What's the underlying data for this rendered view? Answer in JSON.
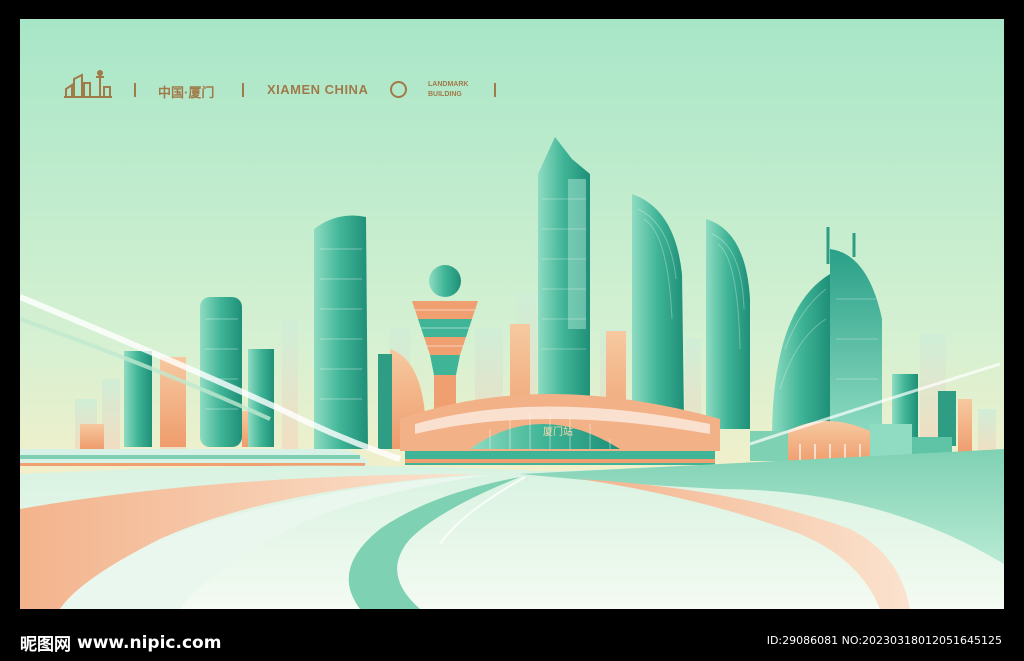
{
  "header": {
    "cn_city": "中国·厦门",
    "en_city": "XIAMEN CHINA",
    "landmark_line1": "LANDMARK",
    "landmark_line2": "BUILDING",
    "logo_icon": "city-skyline-icon"
  },
  "station": {
    "sign": "厦门站"
  },
  "footer": {
    "brand": "昵图网",
    "url": "www.nipic.com",
    "id_text": "ID:29086081 NO:20230318012051645125"
  },
  "colors": {
    "frame": "#000000",
    "accent": "#a07a49",
    "teal": "#3fb496",
    "orange": "#f0a070",
    "mint": "#bfe9d0"
  }
}
